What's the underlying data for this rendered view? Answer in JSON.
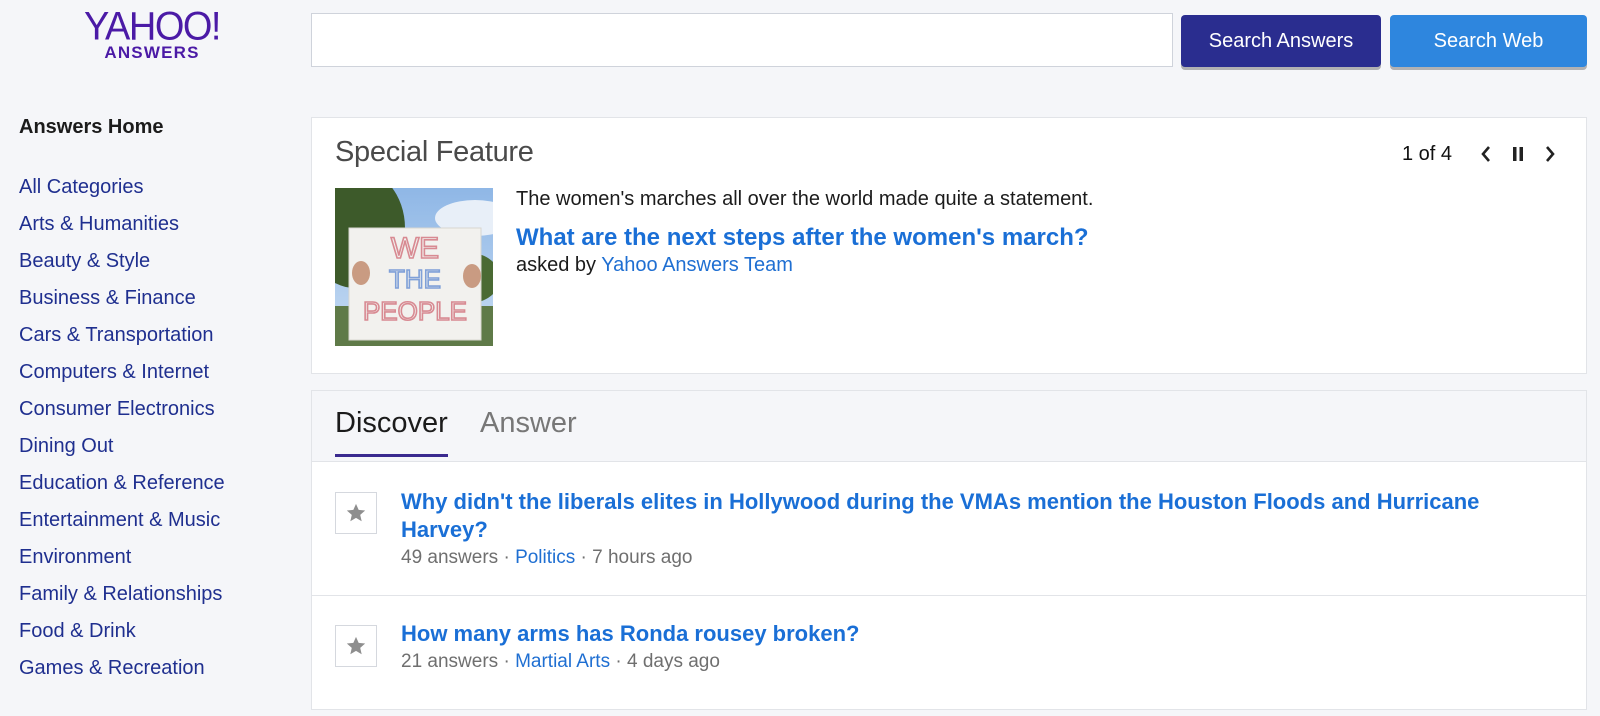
{
  "logo": {
    "main": "YAHOO!",
    "sub": "ANSWERS"
  },
  "search": {
    "value": "",
    "placeholder": "",
    "answers_button": "Search Answers",
    "web_button": "Search Web"
  },
  "sidebar": {
    "home": "Answers Home",
    "items": [
      {
        "label": "All Categories"
      },
      {
        "label": "Arts & Humanities"
      },
      {
        "label": "Beauty & Style"
      },
      {
        "label": "Business & Finance"
      },
      {
        "label": "Cars & Transportation"
      },
      {
        "label": "Computers & Internet"
      },
      {
        "label": "Consumer Electronics"
      },
      {
        "label": "Dining Out"
      },
      {
        "label": "Education & Reference"
      },
      {
        "label": "Entertainment & Music"
      },
      {
        "label": "Environment"
      },
      {
        "label": "Family & Relationships"
      },
      {
        "label": "Food & Drink"
      },
      {
        "label": "Games & Recreation"
      }
    ]
  },
  "feature": {
    "title": "Special Feature",
    "pager": "1 of 4",
    "image_sign_text": [
      "WE",
      "THE",
      "PEOPLE"
    ],
    "description": "The women's marches all over the world made quite a statement.",
    "question": "What are the next steps after the women's march?",
    "asked_by_label": "asked by",
    "asked_by_user": "Yahoo Answers Team"
  },
  "tabs": {
    "discover": "Discover",
    "answer": "Answer"
  },
  "questions": [
    {
      "title": "Why didn't the liberals elites in Hollywood during the VMAs mention the Houston Floods and Hurricane Harvey?",
      "answers": "49 answers",
      "sep1": "·",
      "category": "Politics",
      "sep2": "·",
      "time": "7 hours ago"
    },
    {
      "title": "How many arms has Ronda rousey broken?",
      "answers": "21 answers",
      "sep1": "·",
      "category": "Martial Arts",
      "sep2": "·",
      "time": "4 days ago"
    }
  ],
  "colors": {
    "brand_purple": "#4b1aa6",
    "button_answers": "#2a2d8f",
    "button_web": "#2e86de",
    "link_blue": "#1a6fd6",
    "sidebar_link": "#1f2f8f"
  }
}
